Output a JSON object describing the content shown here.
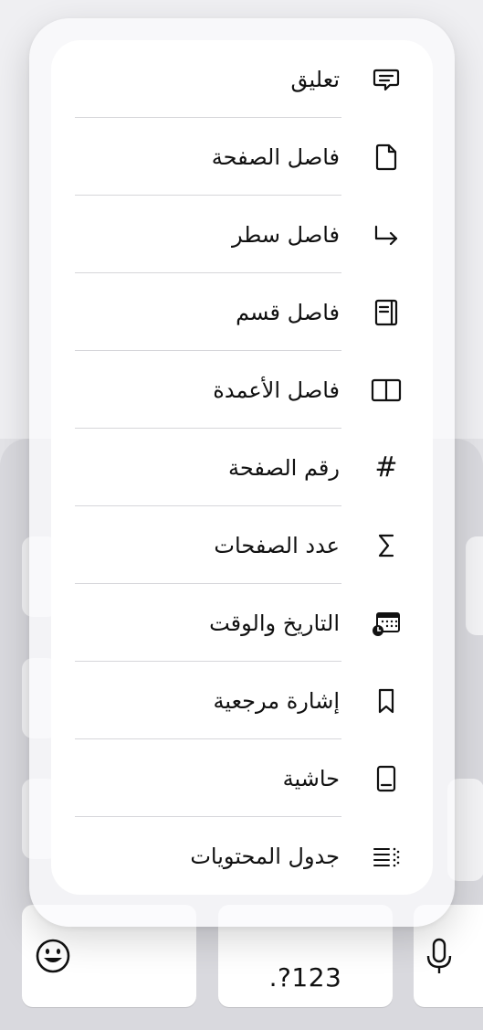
{
  "insert_menu": {
    "items": [
      {
        "label": "تعليق",
        "icon": "comment-icon"
      },
      {
        "label": "فاصل الصفحة",
        "icon": "page-break-icon"
      },
      {
        "label": "فاصل سطر",
        "icon": "line-break-icon"
      },
      {
        "label": "فاصل قسم",
        "icon": "section-break-icon"
      },
      {
        "label": "فاصل الأعمدة",
        "icon": "column-break-icon"
      },
      {
        "label": "رقم الصفحة",
        "icon": "hash-icon",
        "glyph": "#"
      },
      {
        "label": "عدد الصفحات",
        "icon": "sigma-icon"
      },
      {
        "label": "التاريخ والوقت",
        "icon": "calendar-clock-icon"
      },
      {
        "label": "إشارة مرجعية",
        "icon": "bookmark-icon"
      },
      {
        "label": "حاشية",
        "icon": "footer-icon"
      },
      {
        "label": "جدول المحتويات",
        "icon": "toc-icon"
      }
    ]
  },
  "keyboard": {
    "numbers_key_label": ".?123",
    "emoji_icon": "emoji-icon",
    "mic_icon": "microphone-icon"
  }
}
